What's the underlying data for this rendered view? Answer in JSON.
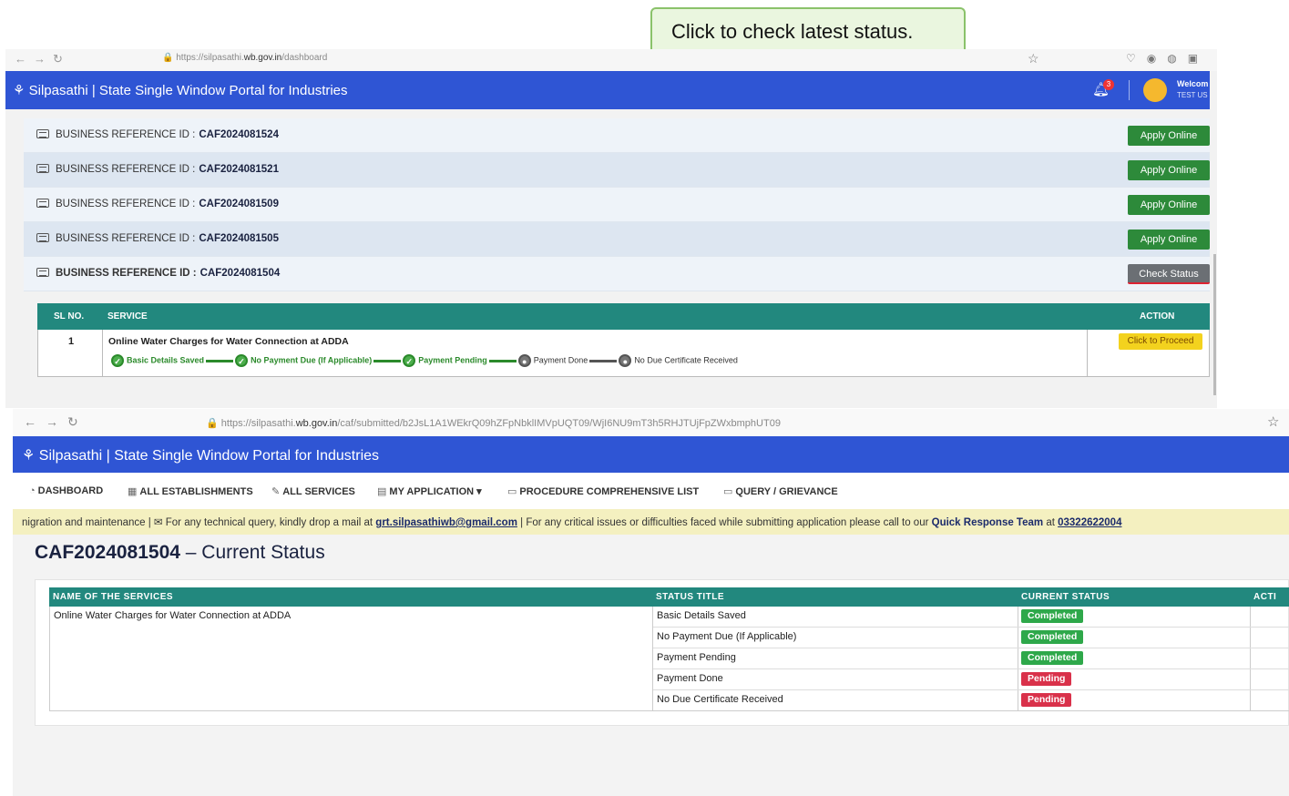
{
  "callout": {
    "text": "Click to check latest status."
  },
  "shot1": {
    "browser": {
      "url_prefix": "https://silpasathi.",
      "url_domain": "wb.gov.in",
      "url_path": "/dashboard"
    },
    "portal_title": "Silpasathi | State Single Window Portal for Industries",
    "notification_count": "3",
    "welcome": "Welcom",
    "user": "TEST US",
    "ref_label": "BUSINESS REFERENCE ID :",
    "refs": [
      {
        "id": "CAF2024081524",
        "button": "Apply Online"
      },
      {
        "id": "CAF2024081521",
        "button": "Apply Online"
      },
      {
        "id": "CAF2024081509",
        "button": "Apply Online"
      },
      {
        "id": "CAF2024081505",
        "button": "Apply Online"
      },
      {
        "id": "CAF2024081504",
        "button": "Check Status"
      }
    ],
    "table": {
      "headers": {
        "sl": "SL NO.",
        "service": "SERVICE",
        "action": "ACTION"
      },
      "row": {
        "sl": "1",
        "service": "Online Water Charges for Water Connection at ADDA",
        "action": "Click to Proceed"
      },
      "steps": [
        {
          "label": "Basic Details Saved",
          "done": true
        },
        {
          "label": "No Payment Due (If Applicable)",
          "done": true
        },
        {
          "label": "Payment Pending",
          "done": true
        },
        {
          "label": "Payment Done",
          "done": false
        },
        {
          "label": "No Due Certificate Received",
          "done": false
        }
      ]
    }
  },
  "shot2": {
    "browser": {
      "url_prefix": "https://silpasathi.",
      "url_domain": "wb.gov.in",
      "url_path": "/caf/submitted/b2JsL1A1WEkrQ09hZFpNbklIMVpUQT09/WjI6NU9mT3h5RHJTUjFpZWxbmphUT09"
    },
    "portal_title": "Silpasathi | State Single Window Portal for Industries",
    "menu": {
      "dashboard": "DASHBOARD",
      "establishments": "ALL ESTABLISHMENTS",
      "services": "ALL SERVICES",
      "my_application": "MY APPLICATION ▾",
      "procedure": "PROCEDURE COMPREHENSIVE LIST",
      "query": "QUERY / GRIEVANCE"
    },
    "notice": {
      "part1": "nigration and maintenance | ",
      "part2": " For any technical query, kindly drop a mail at ",
      "email": "grt.silpasathiwb@gmail.com",
      "part3": " | For any critical issues or difficulties faced while submitting application please call to our ",
      "team": "Quick Response Team",
      "part4": " at ",
      "phone": "03322622004"
    },
    "page_title_id": "CAF2024081504",
    "page_title_rest": " – Current Status",
    "table": {
      "headers": {
        "name": "NAME OF THE SERVICES",
        "status_title": "STATUS TITLE",
        "current_status": "CURRENT STATUS",
        "action": "ACTI"
      },
      "service": "Online Water Charges for Water Connection at ADDA",
      "rows": [
        {
          "title": "Basic Details Saved",
          "status": "Completed"
        },
        {
          "title": "No Payment Due (If Applicable)",
          "status": "Completed"
        },
        {
          "title": "Payment Pending",
          "status": "Completed"
        },
        {
          "title": "Payment Done",
          "status": "Pending"
        },
        {
          "title": "No Due Certificate Received",
          "status": "Pending"
        }
      ]
    }
  }
}
